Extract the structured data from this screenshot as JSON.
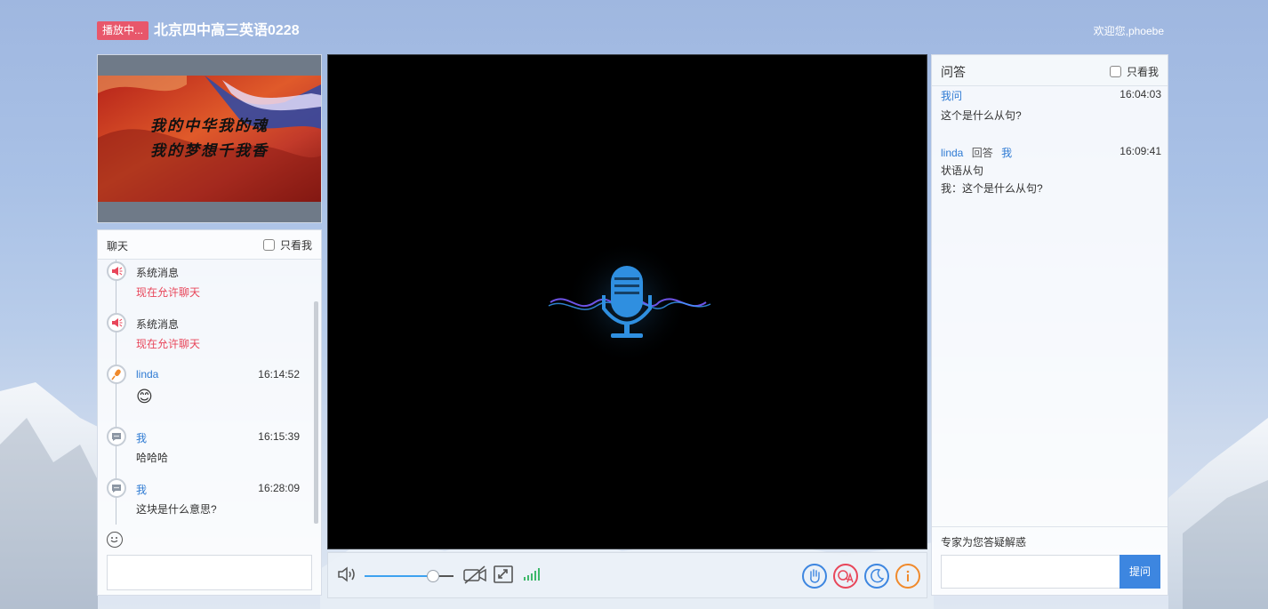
{
  "header": {
    "live_badge": "播放中...",
    "room_title": "北京四中高三英语0228",
    "welcome": "欢迎您,phoebe"
  },
  "slide": {
    "line1": "我的中华我的魂",
    "line2": "我的梦想千我香"
  },
  "chat": {
    "title": "聊天",
    "only_me_label": "只看我",
    "items": [
      {
        "icon": "speaker-icon",
        "name": "系统消息",
        "time": "",
        "message": "现在允许聊天",
        "message_color": "#e8465a",
        "name_color": "#333333"
      },
      {
        "icon": "speaker-icon",
        "name": "系统消息",
        "time": "",
        "message": "现在允许聊天",
        "message_color": "#e8465a",
        "name_color": "#333333"
      },
      {
        "icon": "teacher-mic-icon",
        "name": "linda",
        "time": "16:14:52",
        "message": "😊",
        "message_color": "#333333",
        "name_color": "#2f7bd3"
      },
      {
        "icon": "chat-bubble-icon",
        "name": "我",
        "time": "16:15:39",
        "message": "哈哈哈",
        "message_color": "#333333",
        "name_color": "#2f7bd3"
      },
      {
        "icon": "chat-bubble-icon",
        "name": "我",
        "time": "16:28:09",
        "message": "这块是什么意思?",
        "message_color": "#333333",
        "name_color": "#2f7bd3"
      }
    ]
  },
  "controls": {
    "volume_level": 0.77,
    "signal_color": "#3db86b"
  },
  "qa": {
    "title": "问答",
    "only_me_label": "只看我",
    "items": [
      {
        "asker": "我问",
        "answer_word": "",
        "target": "",
        "time": "16:04:03",
        "lines": [
          "这个是什么从句?"
        ]
      },
      {
        "asker": "linda",
        "answer_word": "回答",
        "target": "我",
        "time": "16:09:41",
        "lines": [
          "状语从句",
          "我：这个是什么从句?"
        ]
      }
    ],
    "hint": "专家为您答疑解惑",
    "ask_button": "提问"
  },
  "colors": {
    "accent": "#3d86e0",
    "live_badge": "#e8576b",
    "raise_hand": "#3d86e0",
    "qa_btn": "#e8465a",
    "night_btn": "#3d86e0",
    "info_btn": "#f08a2c"
  }
}
